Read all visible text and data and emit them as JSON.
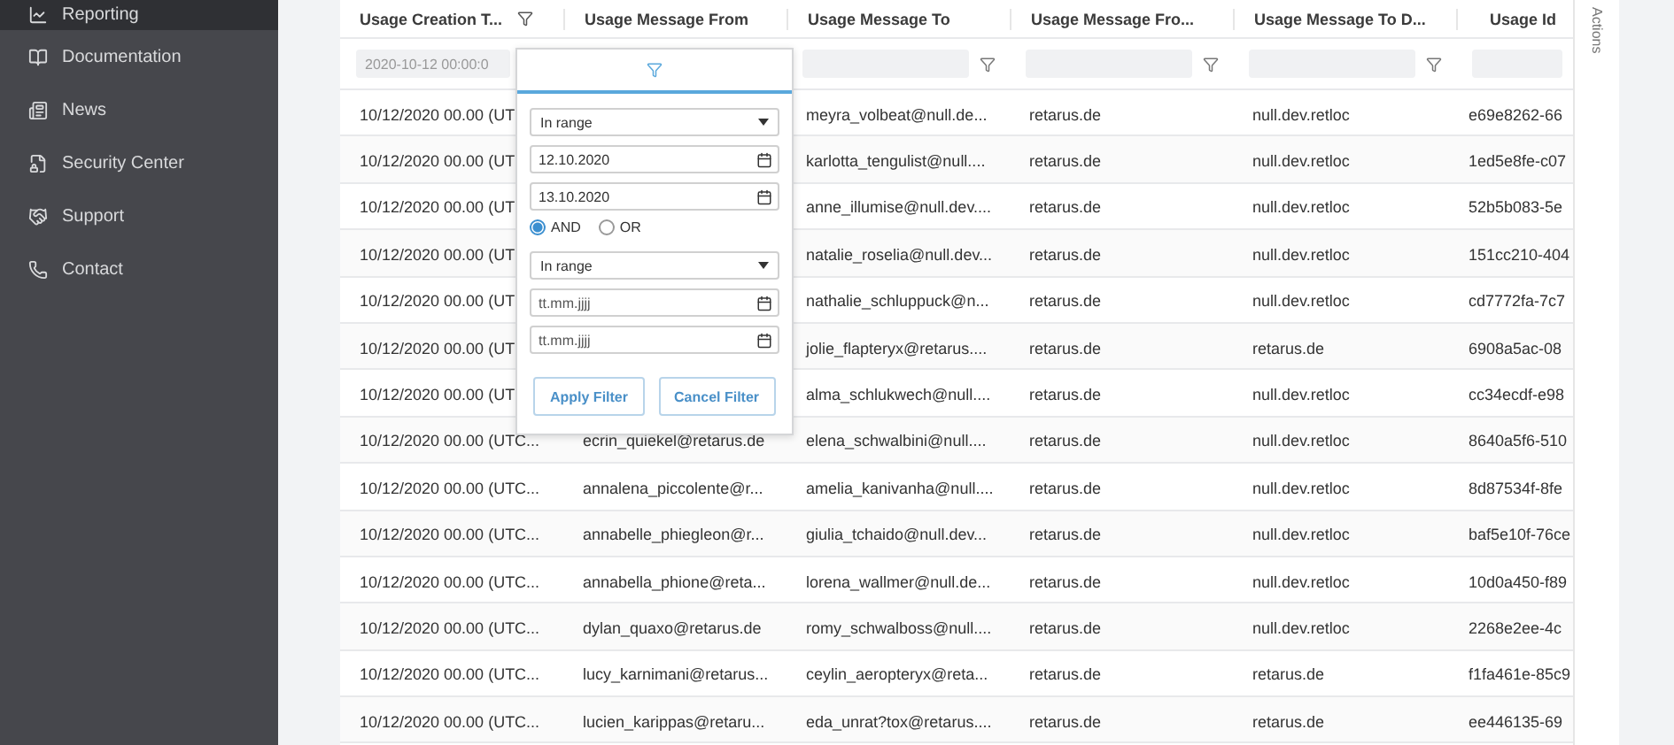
{
  "sidebar": {
    "items": [
      {
        "label": "Reporting",
        "selected": true
      },
      {
        "label": "Documentation",
        "selected": false
      },
      {
        "label": "News",
        "selected": false
      },
      {
        "label": "Security Center",
        "selected": false
      },
      {
        "label": "Support",
        "selected": false
      },
      {
        "label": "Contact",
        "selected": false
      }
    ]
  },
  "table": {
    "columns": [
      {
        "label": "Usage Creation T...",
        "filtered": true
      },
      {
        "label": "Usage Message From",
        "filtered": false
      },
      {
        "label": "Usage Message To",
        "filtered": false
      },
      {
        "label": "Usage Message Fro...",
        "filtered": false
      },
      {
        "label": "Usage Message To D...",
        "filtered": false
      },
      {
        "label": "Usage Id",
        "filtered": false
      }
    ],
    "filter_row": [
      {
        "kind": "field",
        "value": "2020-10-12 00:00:0",
        "icon": false
      },
      {
        "kind": "covered"
      },
      {
        "kind": "field",
        "icon": true
      },
      {
        "kind": "field",
        "icon": true
      },
      {
        "kind": "field",
        "icon": true
      },
      {
        "kind": "field",
        "icon": false
      }
    ],
    "rows": [
      {
        "cells": [
          "10/12/2020 00.00 (UT",
          null,
          "meyra_volbeat@null.de...",
          "retarus.de",
          "null.dev.retloc",
          "e69e8262-66"
        ]
      },
      {
        "cells": [
          "10/12/2020 00.00 (UT",
          null,
          "karlotta_tengulist@null....",
          "retarus.de",
          "null.dev.retloc",
          "1ed5e8fe-c07"
        ]
      },
      {
        "cells": [
          "10/12/2020 00.00 (UT",
          null,
          "anne_illumise@null.dev....",
          "retarus.de",
          "null.dev.retloc",
          "52b5b083-5e"
        ]
      },
      {
        "cells": [
          "10/12/2020 00.00 (UT",
          null,
          "natalie_roselia@null.dev...",
          "retarus.de",
          "null.dev.retloc",
          "151cc210-404"
        ]
      },
      {
        "cells": [
          "10/12/2020 00.00 (UT",
          null,
          "nathalie_schluppuck@n...",
          "retarus.de",
          "null.dev.retloc",
          "cd7772fa-7c7"
        ]
      },
      {
        "cells": [
          "10/12/2020 00.00 (UT",
          null,
          "jolie_flapteryx@retarus....",
          "retarus.de",
          "retarus.de",
          "6908a5ac-08"
        ]
      },
      {
        "cells": [
          "10/12/2020 00.00 (UT",
          null,
          "alma_schlukwech@null....",
          "retarus.de",
          "null.dev.retloc",
          "cc34ecdf-e98"
        ]
      },
      {
        "cells": [
          "10/12/2020 00.00 (UTC...",
          "ecrin_quiekel@retarus.de",
          "elena_schwalbini@null....",
          "retarus.de",
          "null.dev.retloc",
          "8640a5f6-510"
        ]
      },
      {
        "cells": [
          "10/12/2020 00.00 (UTC...",
          "annalena_piccolente@r...",
          "amelia_kanivanha@null....",
          "retarus.de",
          "null.dev.retloc",
          "8d87534f-8fe"
        ]
      },
      {
        "cells": [
          "10/12/2020 00.00 (UTC...",
          "annabelle_phiegleon@r...",
          "giulia_tchaido@null.dev...",
          "retarus.de",
          "null.dev.retloc",
          "baf5e10f-76ce"
        ]
      },
      {
        "cells": [
          "10/12/2020 00.00 (UTC...",
          "annabella_phione@reta...",
          "lorena_wallmer@null.de...",
          "retarus.de",
          "null.dev.retloc",
          "10d0a450-f89"
        ]
      },
      {
        "cells": [
          "10/12/2020 00.00 (UTC...",
          "dylan_quaxo@retarus.de",
          "romy_schwalboss@null....",
          "retarus.de",
          "null.dev.retloc",
          "2268e2ee-4c"
        ]
      },
      {
        "cells": [
          "10/12/2020 00.00 (UTC...",
          "lucy_karnimani@retarus...",
          "ceylin_aeropteryx@reta...",
          "retarus.de",
          "retarus.de",
          "f1fa461e-85c9"
        ]
      },
      {
        "cells": [
          "10/12/2020 00.00 (UTC...",
          "lucien_karippas@retaru...",
          "eda_unrat?tox@retarus....",
          "retarus.de",
          "retarus.de",
          "ee446135-69"
        ]
      }
    ],
    "actions_label": "Actions"
  },
  "filter_popup": {
    "conditions": [
      {
        "operator": "In range",
        "from": {
          "value": "12.10.2020"
        },
        "to": {
          "value": "13.10.2020"
        }
      },
      {
        "operator": "In range",
        "from": {
          "placeholder": "tt.mm.jjjj"
        },
        "to": {
          "placeholder": "tt.mm.jjjj"
        }
      }
    ],
    "join": [
      {
        "label": "AND",
        "selected": true
      },
      {
        "label": "OR",
        "selected": false
      }
    ],
    "buttons": [
      "Apply Filter",
      "Cancel Filter"
    ]
  }
}
